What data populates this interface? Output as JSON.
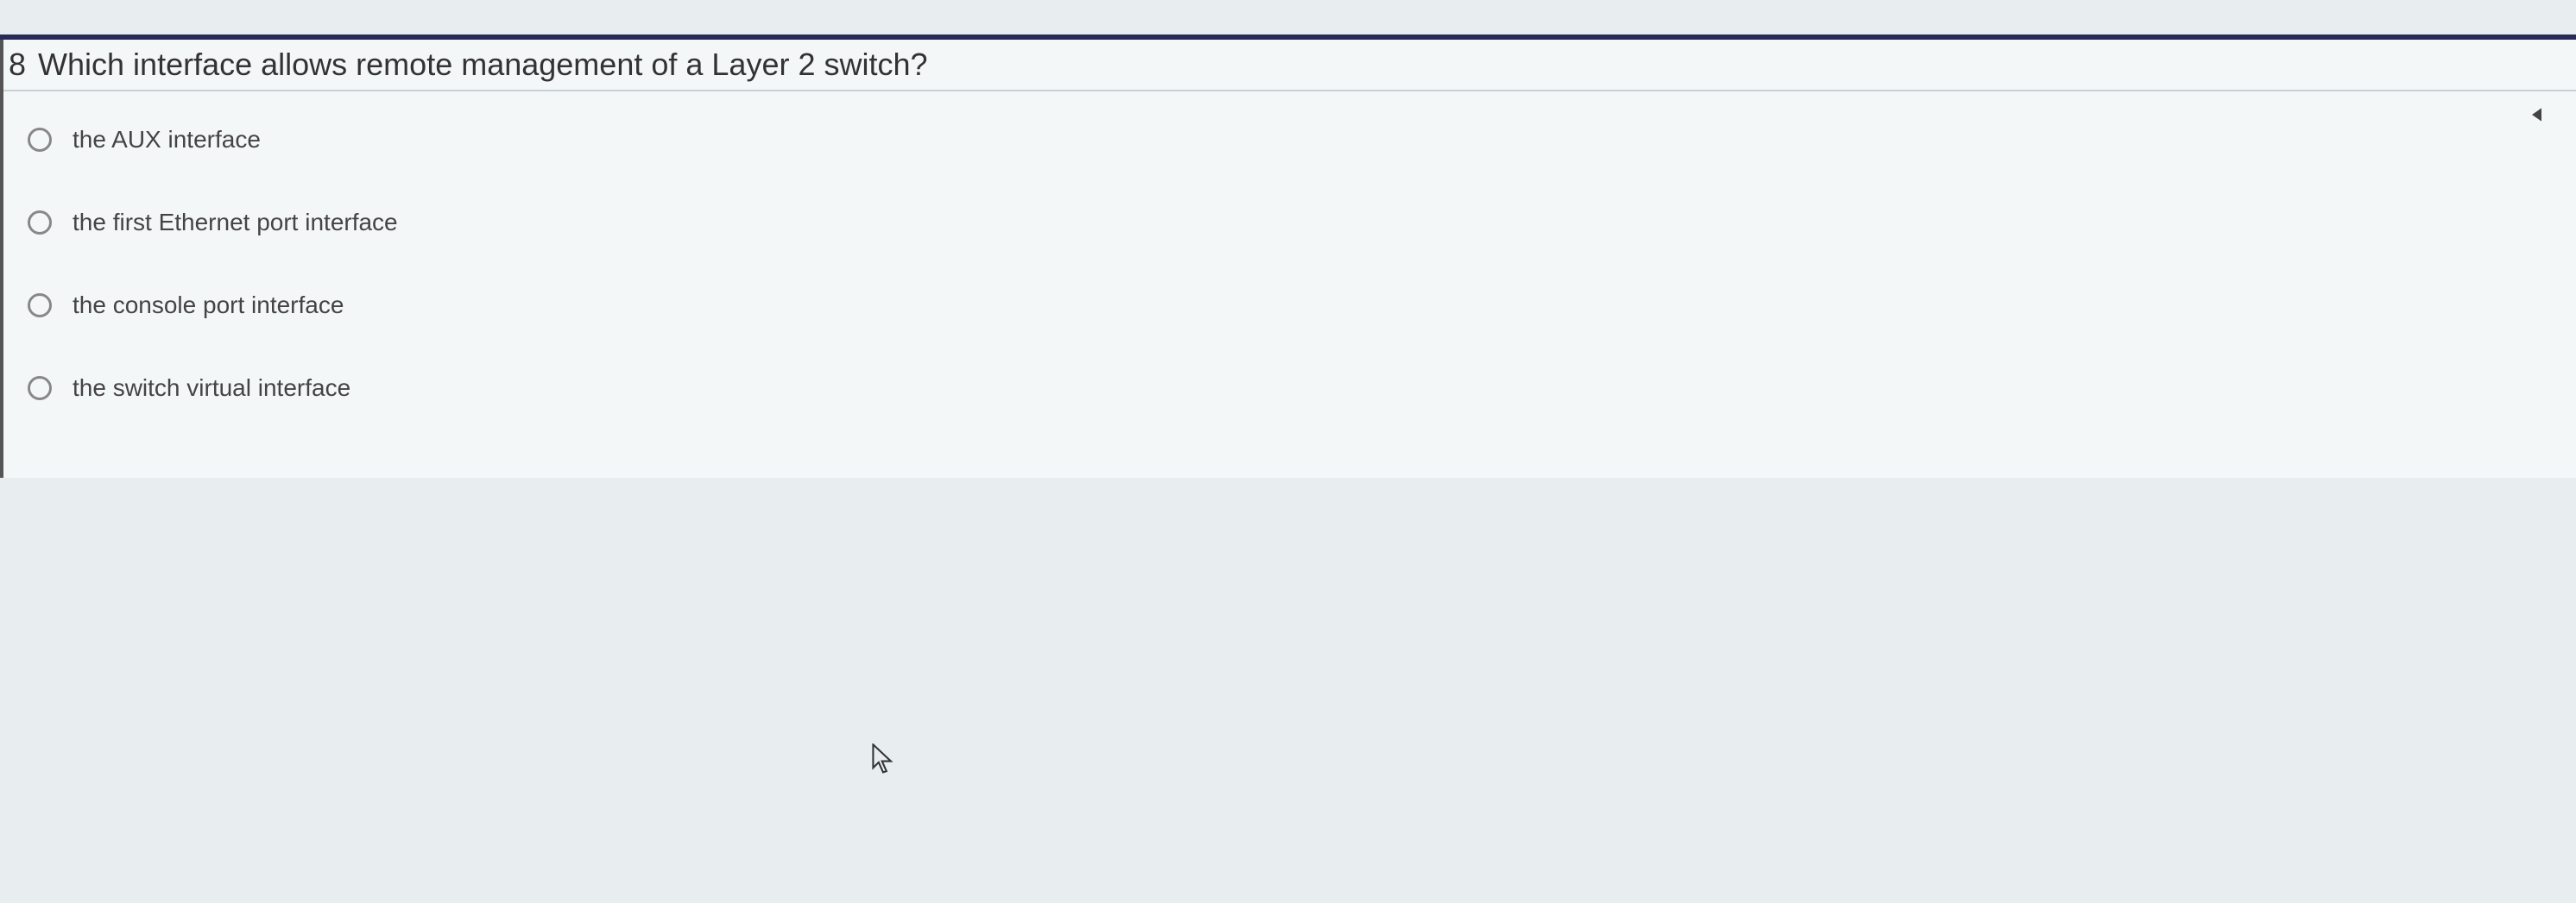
{
  "question": {
    "number": "8",
    "text": "Which interface allows remote management of a Layer 2 switch?"
  },
  "options": [
    {
      "label": "the AUX interface"
    },
    {
      "label": "the first Ethernet port interface"
    },
    {
      "label": "the console port interface"
    },
    {
      "label": "the switch virtual interface"
    }
  ],
  "collapse_glyph": "◂"
}
